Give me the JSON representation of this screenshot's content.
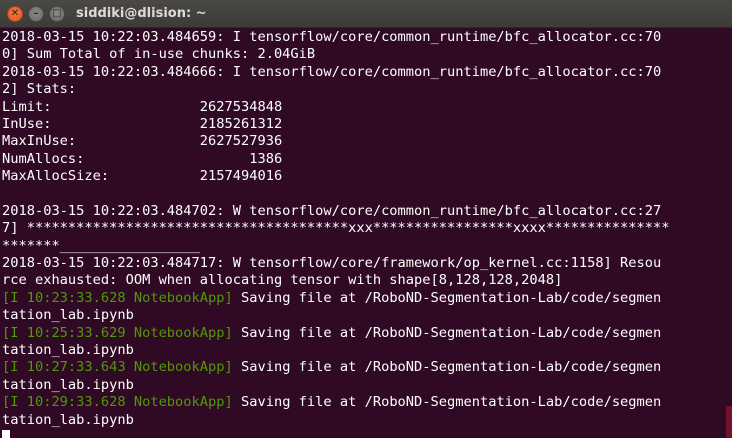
{
  "window": {
    "title": "siddiki@dlision: ~",
    "close_glyph": "✕",
    "minimize_glyph": "–",
    "maximize_glyph": "□"
  },
  "colors": {
    "terminal_background": "#300a24",
    "text": "#ffffff",
    "notebook_prefix": "#4e9a06"
  },
  "terminal": {
    "lines": [
      {
        "text": "2018-03-15 10:22:03.484659: I tensorflow/core/common_runtime/bfc_allocator.cc:70"
      },
      {
        "text": "0] Sum Total of in-use chunks: 2.04GiB"
      },
      {
        "text": "2018-03-15 10:22:03.484666: I tensorflow/core/common_runtime/bfc_allocator.cc:70"
      },
      {
        "text": "2] Stats:"
      },
      {
        "text": "Limit:                  2627534848"
      },
      {
        "text": "InUse:                  2185261312"
      },
      {
        "text": "MaxInUse:               2627527936"
      },
      {
        "text": "NumAllocs:                    1386"
      },
      {
        "text": "MaxAllocSize:           2157494016"
      },
      {
        "text": ""
      },
      {
        "text": "2018-03-15 10:22:03.484702: W tensorflow/core/common_runtime/bfc_allocator.cc:27"
      },
      {
        "text": "7] ***************************************xxx*****************xxxx***************"
      },
      {
        "text": "*******_________________"
      },
      {
        "text": "2018-03-15 10:22:03.484717: W tensorflow/core/framework/op_kernel.cc:1158] Resou"
      },
      {
        "text": "rce exhausted: OOM when allocating tensor with shape[8,128,128,2048]"
      },
      {
        "prefix": "[I 10:23:33.628 NotebookApp]",
        "text": " Saving file at /RoboND-Segmentation-Lab/code/segmen"
      },
      {
        "text": "tation_lab.ipynb"
      },
      {
        "prefix": "[I 10:25:33.629 NotebookApp]",
        "text": " Saving file at /RoboND-Segmentation-Lab/code/segmen"
      },
      {
        "text": "tation_lab.ipynb"
      },
      {
        "prefix": "[I 10:27:33.643 NotebookApp]",
        "text": " Saving file at /RoboND-Segmentation-Lab/code/segmen"
      },
      {
        "text": "tation_lab.ipynb"
      },
      {
        "prefix": "[I 10:29:33.628 NotebookApp]",
        "text": " Saving file at /RoboND-Segmentation-Lab/code/segmen"
      },
      {
        "text": "tation_lab.ipynb"
      }
    ]
  }
}
